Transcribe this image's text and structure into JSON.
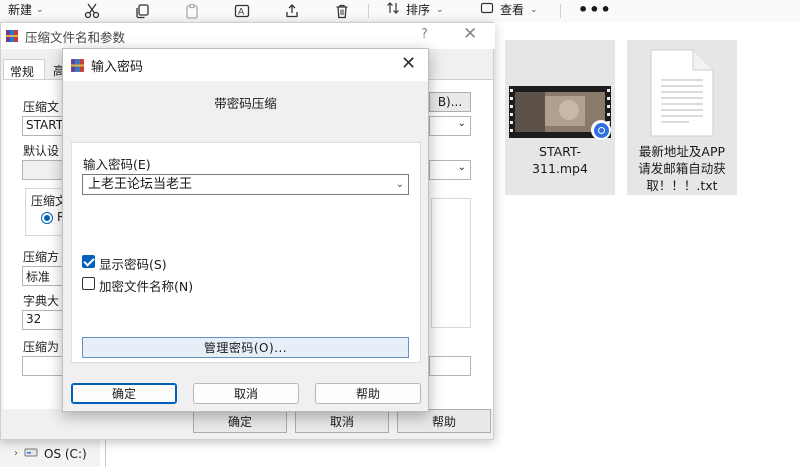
{
  "explorer": {
    "toolbar": {
      "new_label": "新建",
      "sort_label": "排序",
      "view_label": "查看",
      "more_label": "•••"
    },
    "files": [
      {
        "name": "START-311.mp4",
        "type": "video"
      },
      {
        "name": "最新地址及APP请发邮箱自动获取！！！.txt",
        "type": "text"
      }
    ],
    "drive_label": "OS (C:)"
  },
  "back_dialog": {
    "title": "压缩文件名和参数",
    "help": "?",
    "tabs": [
      "常规",
      "高"
    ],
    "archive_name_label": "压缩文",
    "archive_name_value": "START-",
    "browse_label": "B)...",
    "profile_label": "默认设",
    "format_group_label": "压缩文",
    "format_option": "R",
    "method_label": "压缩方",
    "method_value": "标准",
    "dict_label": "字典大",
    "dict_value": "32",
    "split_label": "压缩为",
    "ok": "确定",
    "cancel": "取消",
    "help_btn": "帮助"
  },
  "password_dialog": {
    "title": "输入密码",
    "heading": "带密码压缩",
    "password_label": "输入密码(E)",
    "password_value": "上老王论坛当老王",
    "show_password_label": "显示密码(S)",
    "show_password_checked": true,
    "encrypt_names_label": "加密文件名称(N)",
    "encrypt_names_checked": false,
    "manage_label": "管理密码(O)...",
    "ok": "确定",
    "cancel": "取消",
    "help": "帮助",
    "accent": "#005fb8"
  }
}
